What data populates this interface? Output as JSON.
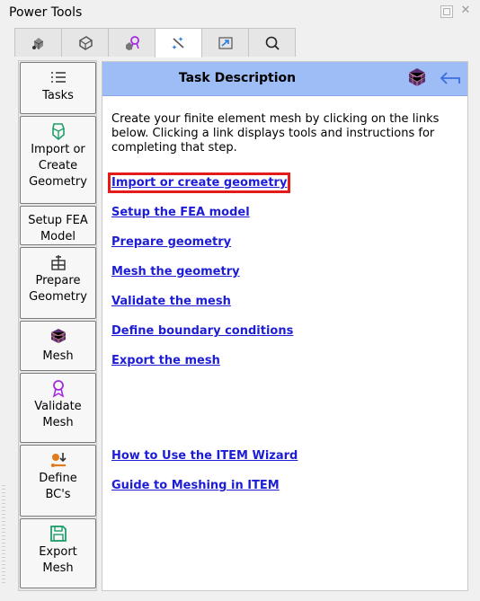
{
  "window": {
    "title": "Power Tools"
  },
  "tabs": [
    {
      "icon": "geometry-icon"
    },
    {
      "icon": "solid-icon"
    },
    {
      "icon": "mesh-quality-icon"
    },
    {
      "icon": "wizard-icon",
      "active": true
    },
    {
      "icon": "export-icon"
    },
    {
      "icon": "search-icon"
    }
  ],
  "sidebar": {
    "items": [
      {
        "label": "Tasks",
        "icon": "list-icon"
      },
      {
        "label": "Import or Create Geometry",
        "icon": "geometry-icon"
      },
      {
        "label": "Setup FEA Model",
        "icon": ""
      },
      {
        "label": "Prepare Geometry",
        "icon": "prepare-icon"
      },
      {
        "label": "Mesh",
        "icon": "mesh-cube-icon"
      },
      {
        "label": "Validate Mesh",
        "icon": "ribbon-icon"
      },
      {
        "label": "Define BC's",
        "icon": "boundary-conditions-icon"
      },
      {
        "label": "Export Mesh",
        "icon": "save-icon"
      }
    ]
  },
  "panel": {
    "title": "Task Description",
    "description": "Create your finite element mesh by clicking on the links below. Clicking a link displays tools and instructions for completing that step.",
    "links": [
      "Import or create geometry",
      "Setup the FEA model",
      "Prepare geometry",
      "Mesh the geometry",
      "Validate the mesh",
      "Define boundary conditions",
      "Export the mesh"
    ],
    "help_links": [
      "How to Use the ITEM Wizard",
      "Guide to Meshing in ITEM"
    ]
  },
  "colors": {
    "header": "#9ebcf5",
    "link": "#1d1dd6",
    "focus_outline": "#e31b1b",
    "icon_green": "#1e9e6a",
    "icon_purple": "#a22ce0"
  }
}
